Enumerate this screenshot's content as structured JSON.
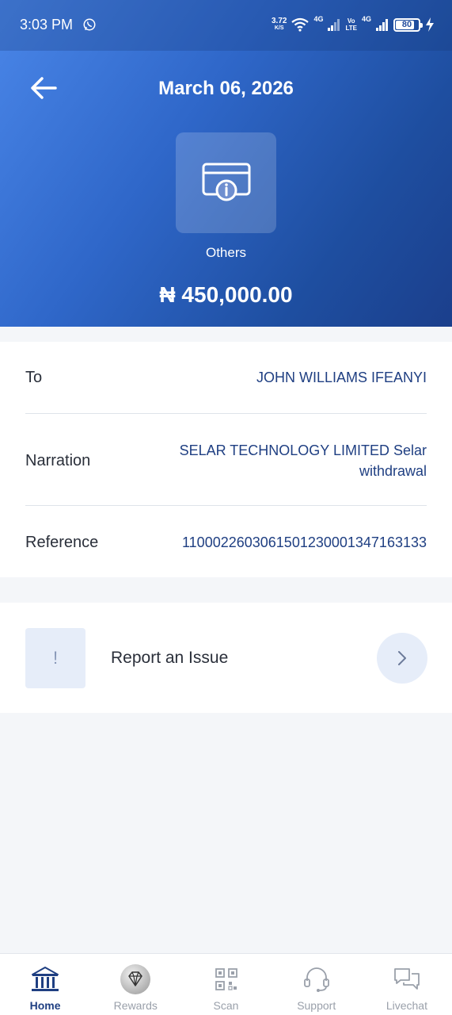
{
  "status_bar": {
    "time": "3:03 PM",
    "net_speed": "3.72",
    "net_unit": "K/S",
    "sim1_label": "4G",
    "volte_top": "Vo",
    "volte_bottom": "LTE",
    "sim2_label": "4G",
    "battery": "80"
  },
  "header": {
    "date": "March 06, 2026",
    "category": "Others",
    "amount": "₦ 450,000.00",
    "category_icon": "card-info-icon"
  },
  "details": [
    {
      "label": "To",
      "value": "JOHN WILLIAMS IFEANYI"
    },
    {
      "label": "Narration",
      "value_line1": "SELAR TECHNOLOGY LIMITED Selar",
      "value_line2": "withdrawal"
    },
    {
      "label": "Reference",
      "value": "1100022603061501230001347163133"
    }
  ],
  "report": {
    "icon_glyph": "!",
    "label": "Report an Issue"
  },
  "nav": [
    {
      "label": "Home",
      "icon": "bank-icon",
      "active": true
    },
    {
      "label": "Rewards",
      "icon": "diamond-icon",
      "active": false
    },
    {
      "label": "Scan",
      "icon": "qr-code-icon",
      "active": false
    },
    {
      "label": "Support",
      "icon": "headset-icon",
      "active": false
    },
    {
      "label": "Livechat",
      "icon": "chat-icon",
      "active": false
    }
  ],
  "colors": {
    "gradient_start": "#4a86e8",
    "gradient_end": "#1b3f8c",
    "accent_text": "#1f3f82",
    "page_bg": "#f4f6f9"
  }
}
